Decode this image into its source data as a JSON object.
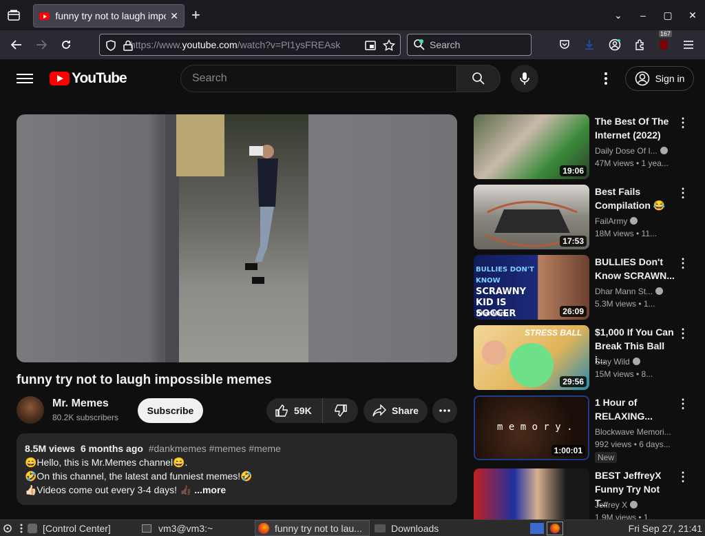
{
  "browser": {
    "tab_title": "funny try not to laugh impos",
    "tab_close": "✕",
    "new_tab": "+",
    "url_prefix": "https://www.",
    "url_domain": "youtube.com",
    "url_path": "/watch?v=PI1ysFREAsk",
    "search_placeholder": "Search",
    "extensions_badge": "167",
    "window_controls": [
      "⌄",
      "–",
      "▢",
      "✕"
    ]
  },
  "youtube": {
    "logo_text": "YouTube",
    "search_placeholder": "Search",
    "signin_label": "Sign in"
  },
  "video": {
    "title": "funny try not to laugh impossible memes",
    "channel": "Mr. Memes",
    "subscribers": "80.2K subscribers",
    "subscribe_label": "Subscribe",
    "likes": "59K",
    "share_label": "Share",
    "views": "8.5M views",
    "age": "6 months ago",
    "tags": "#dankmemes #memes #meme",
    "desc_line1": "😄Hello, this is Mr.Memes channel😄.",
    "desc_line2": "🤣On this channel, the latest and funniest memes!🤣",
    "desc_line3": "👍🏻Videos come out every 3-4 days! 👍🏿",
    "more_label": "...more"
  },
  "related": [
    {
      "title": "The Best Of The Internet (2022)",
      "channel": "Daily Dose Of I...",
      "stats": "47M views  • 1 yea...",
      "duration": "19:06",
      "verified": true,
      "thumb_bg": "#4a5a3a"
    },
    {
      "title": "Best Fails Compilation 😂",
      "channel": "FailArmy",
      "stats": "18M views  • 11...",
      "duration": "17:53",
      "verified": true,
      "thumb_bg": "#b5a89a"
    },
    {
      "title": "BULLIES Don't Know SCRAWN...",
      "channel": "Dhar Mann St...",
      "stats": "5.3M views  • 1...",
      "duration": "26:09",
      "verified": true,
      "thumb_bg": "#2b2f6a"
    },
    {
      "title": "$1,000 If You Can Break This Ball i...",
      "channel": "Stay Wild",
      "stats": "15M views  • 8...",
      "duration": "29:56",
      "verified": true,
      "thumb_bg": "#e0c27a"
    },
    {
      "title": "1 Hour of RELAXING...",
      "channel": "Blockwave Memori...",
      "stats": "992 views  • 6 days...",
      "duration": "1:00:01",
      "verified": false,
      "badge": "New",
      "thumb_bg": "#2a1a14"
    },
    {
      "title": "BEST JeffreyX Funny Try Not T...",
      "channel": "Jeffrey X",
      "stats": "1.9M views  • 1...",
      "duration": "",
      "verified": true,
      "thumb_bg": "#5a3a7a"
    }
  ],
  "thumb_text": {
    "dharmann_1": "BULLIES DON'T KNOW",
    "dharmann_2": "SCRAWNY KID IS",
    "dharmann_3": "SOCCER LEGEND",
    "dharmann_brand": "Dhar Mann",
    "stressball": "STRESS BALL",
    "memory": "m e m o r y ."
  },
  "taskbar": {
    "control_center": "[Control Center]",
    "terminal": "vm3@vm3:~",
    "firefox": "funny try not to lau...",
    "downloads": "Downloads",
    "clock": "Fri Sep 27, 21:41"
  }
}
